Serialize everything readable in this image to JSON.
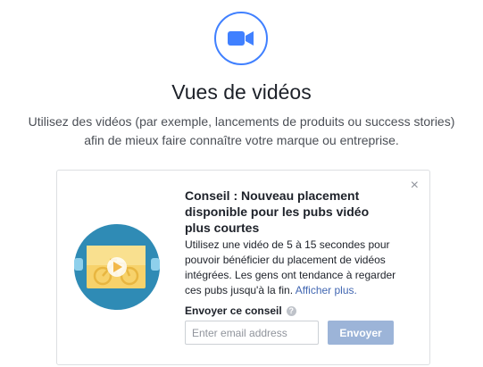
{
  "header": {
    "title": "Vues de vidéos",
    "subtitle": "Utilisez des vidéos (par exemple, lancements de produits ou success stories) afin de mieux faire connaître votre marque ou entreprise."
  },
  "tip_card": {
    "title": "Conseil : Nouveau placement disponible pour les pubs vidéo plus courtes",
    "body": "Utilisez une vidéo de 5 à 15 secondes pour pouvoir bénéficier du placement de vidéos intégrées. Les gens ont tendance à regarder ces pubs jusqu'à la fin.",
    "link_label": "Afficher plus.",
    "close_label": "×",
    "send_label": "Envoyer ce conseil",
    "info_icon_glyph": "?",
    "email": {
      "value": "",
      "placeholder": "Enter email address"
    },
    "send_button": "Envoyer"
  },
  "icons": {
    "hero": "video-camera-icon",
    "illustration": "bicycle-video-illustration",
    "info": "info-icon",
    "close": "close-icon"
  },
  "colors": {
    "accent": "#4080ff",
    "link": "#4267b2",
    "button_disabled": "#9cb4d8",
    "border": "#dddfe2"
  }
}
